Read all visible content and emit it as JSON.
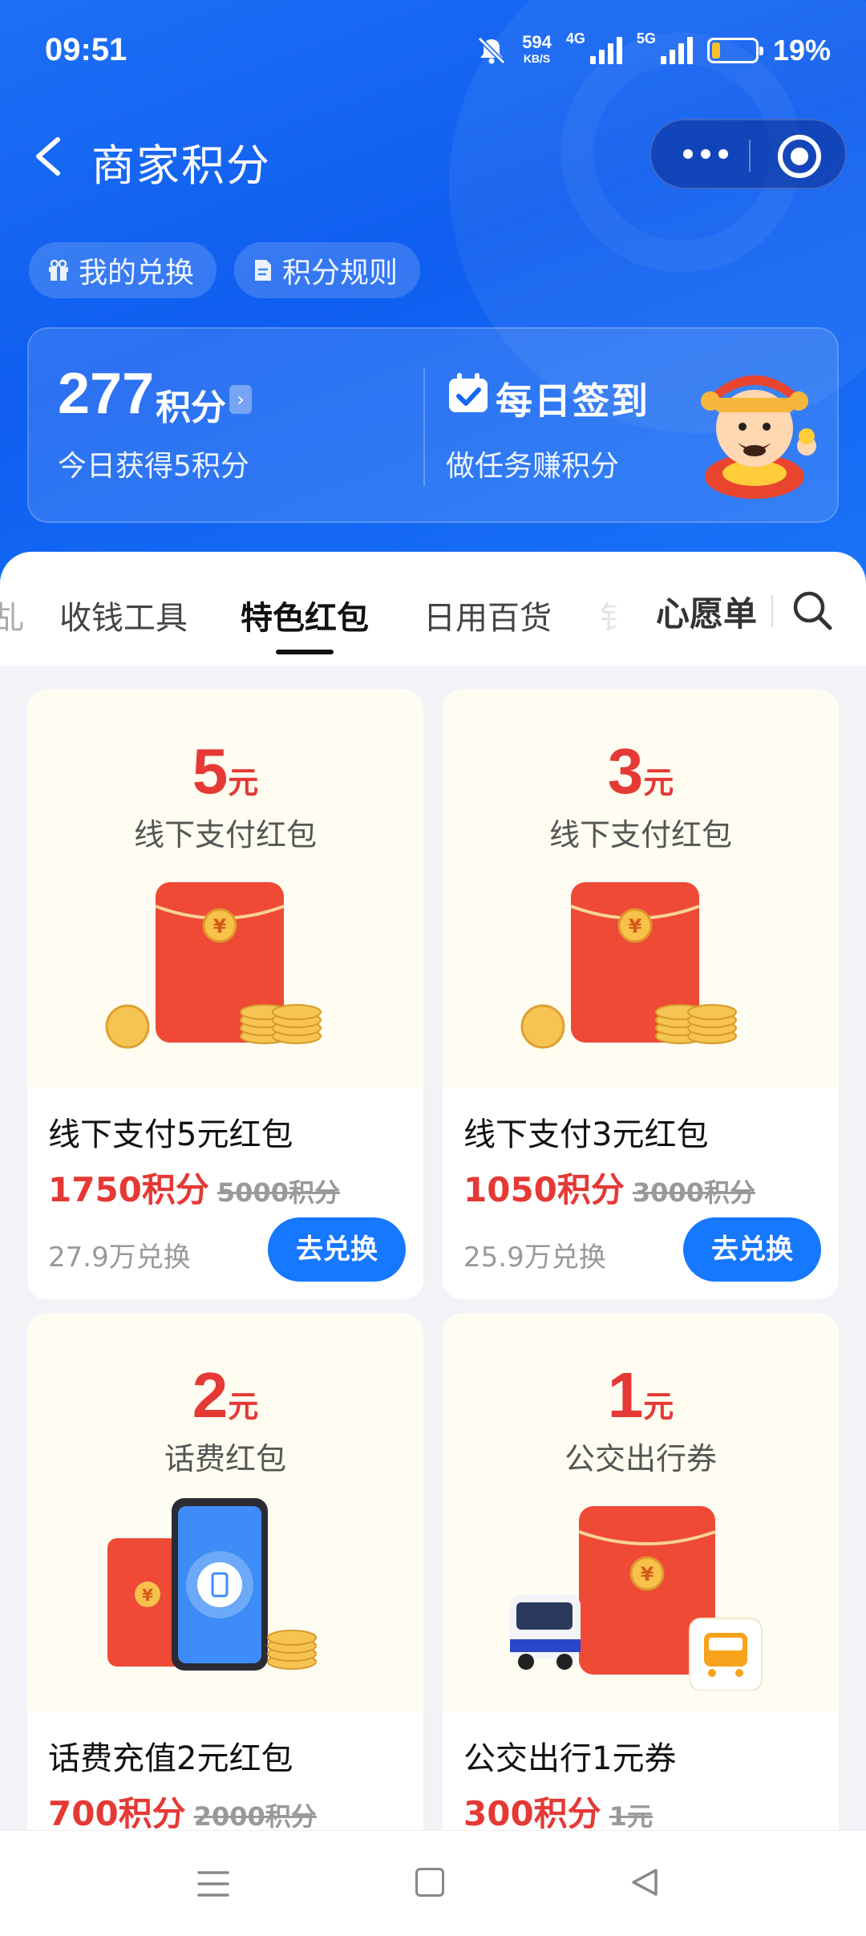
{
  "status_bar": {
    "time": "09:51",
    "net_speed": "594",
    "net_speed_unit": "KB/S",
    "net1": "4G",
    "net2": "5G",
    "battery": "19%",
    "battery_level": 0.19
  },
  "nav": {
    "title": "商家积分"
  },
  "chips": [
    {
      "label": "我的兑换",
      "icon": "gift-icon"
    },
    {
      "label": "积分规则",
      "icon": "document-icon"
    }
  ],
  "points": {
    "value": "277",
    "unit": "积分",
    "today": "今日获得5积分",
    "sign_title": "每日签到",
    "sign_sub": "做任务赚积分"
  },
  "tabs": [
    {
      "label": "收钱工具"
    },
    {
      "label": "特色红包",
      "active": true
    },
    {
      "label": "日用百货"
    }
  ],
  "wishlist": "心愿单",
  "cards": [
    {
      "amount": "5",
      "unit": "元",
      "subtitle": "线下支付红包",
      "name": "线下支付5元红包",
      "price": "1750积分",
      "old_price": "5000积分",
      "count": "27.9万兑换",
      "button": "去兑换"
    },
    {
      "amount": "3",
      "unit": "元",
      "subtitle": "线下支付红包",
      "name": "线下支付3元红包",
      "price": "1050积分",
      "old_price": "3000积分",
      "count": "25.9万兑换",
      "button": "去兑换"
    },
    {
      "amount": "2",
      "unit": "元",
      "subtitle": "话费红包",
      "name": "话费充值2元红包",
      "price": "700积分",
      "old_price": "2000积分"
    },
    {
      "amount": "1",
      "unit": "元",
      "subtitle": "公交出行券",
      "name": "公交出行1元券",
      "price": "300积分",
      "old_price": "1元"
    }
  ],
  "colors": {
    "primary_blue": "#1677ff",
    "price_red": "#e53935",
    "card_cream": "#fffdf1"
  }
}
